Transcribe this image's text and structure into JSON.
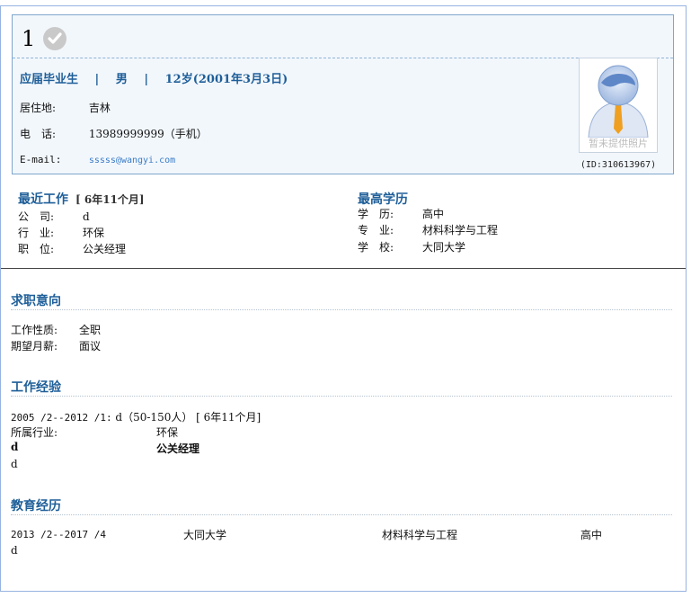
{
  "header": {
    "name": "1",
    "status": "应届毕业生",
    "sep1": "|",
    "gender": "男",
    "sep2": "|",
    "age": "12岁(2001年3月3日)",
    "location_label": "居住地:",
    "location": "吉林",
    "phone_label": "电　话:",
    "phone": "13989999999（手机）",
    "email_label": "E-mail:",
    "email": "sssss@wangyi.com",
    "photo_caption": "暂未提供照片",
    "id_text": "(ID:310613967)"
  },
  "recent_work": {
    "title": "最近工作",
    "duration": "[ 6年11个月]",
    "company_label": "公　司:",
    "company": "d",
    "industry_label": "行　业:",
    "industry": "环保",
    "position_label": "职　位:",
    "position": "公关经理"
  },
  "education_top": {
    "title": "最高学历",
    "degree_label": "学　历:",
    "degree": "高中",
    "major_label": "专　业:",
    "major": "材料科学与工程",
    "school_label": "学　校:",
    "school": "大同大学"
  },
  "intention": {
    "title": "求职意向",
    "type_label": "工作性质:",
    "type": "全职",
    "salary_label": "期望月薪:",
    "salary": "面议"
  },
  "experience": {
    "title": "工作经验",
    "period": "2005 /2--2012 /1:",
    "company": "d（50-150人） [ 6年11个月]",
    "industry_label": "所属行业:",
    "industry": "环保",
    "dept": "d",
    "position": "公关经理",
    "desc": "d"
  },
  "education": {
    "title": "教育经历",
    "period": "2013 /2--2017 /4",
    "school": "大同大学",
    "major": "材料科学与工程",
    "degree": "高中",
    "desc": "d"
  },
  "colors": {
    "accent": "#1f5f99",
    "border": "#97b3e0",
    "header_bg": "#f2f7fc"
  }
}
